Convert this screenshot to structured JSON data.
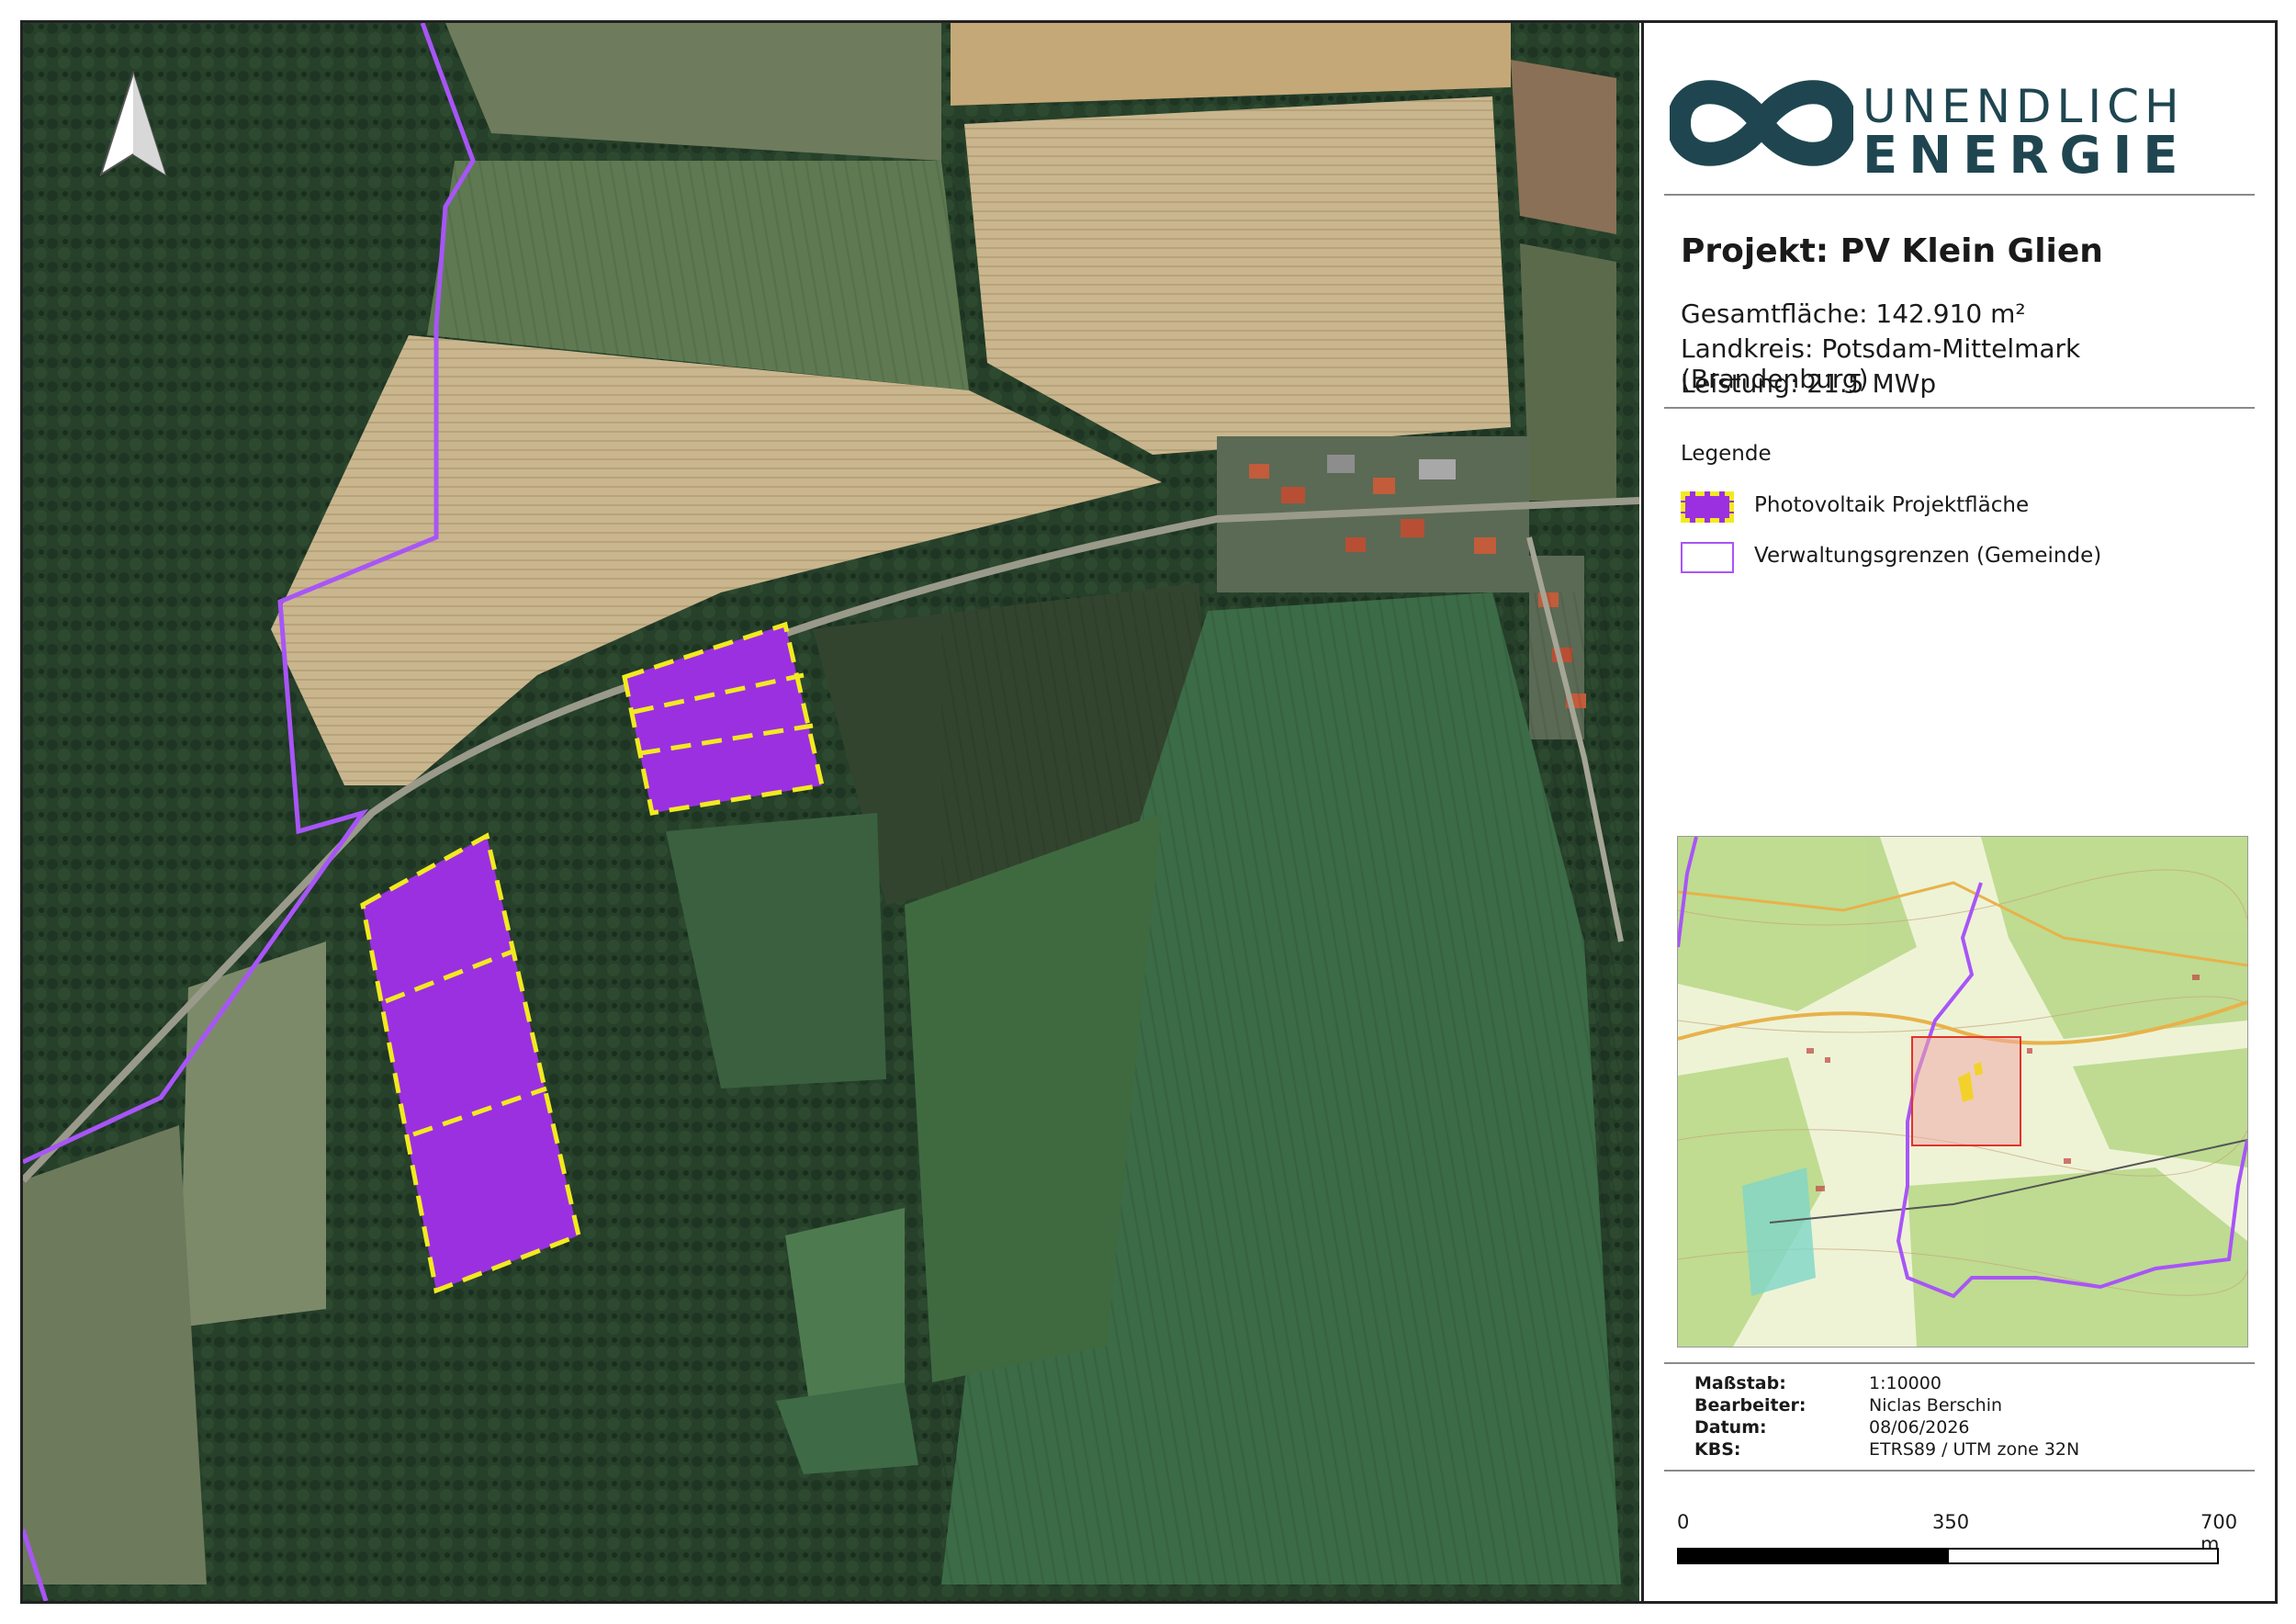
{
  "brand": {
    "line1": "UNENDLICH",
    "line2": "ENERGIE",
    "color": "#1f4650"
  },
  "project": {
    "title": "Projekt: PV Klein Glien",
    "area": "Gesamtfläche: 142.910 m²",
    "district": "Landkreis: Potsdam-Mittelmark (Brandenburg)",
    "power": "Leistung: 21.5 MWp"
  },
  "legend": {
    "title": "Legende",
    "items": [
      {
        "label": "Photovoltaik Projektfläche",
        "fill": "#9b30e0",
        "stroke": "#f2ea20"
      },
      {
        "label": "Verwaltungsgrenzen (Gemeinde)",
        "fill": "#ffffff",
        "stroke": "#a855f7"
      }
    ]
  },
  "meta": [
    {
      "key": "Maßstab:",
      "value": "1:10000"
    },
    {
      "key": "Bearbeiter:",
      "value": "Niclas Berschin"
    },
    {
      "key": "Datum:",
      "value": "08/06/2026"
    },
    {
      "key": "KBS:",
      "value": "ETRS89 / UTM zone 32N"
    }
  ],
  "scale": {
    "labels": [
      "0",
      "350",
      "700 m"
    ]
  },
  "map": {
    "north_arrow": "north-arrow-icon",
    "pv_color": "#9b30e0",
    "pv_outline": "#f2ea20",
    "boundary_color": "#a855f7"
  }
}
